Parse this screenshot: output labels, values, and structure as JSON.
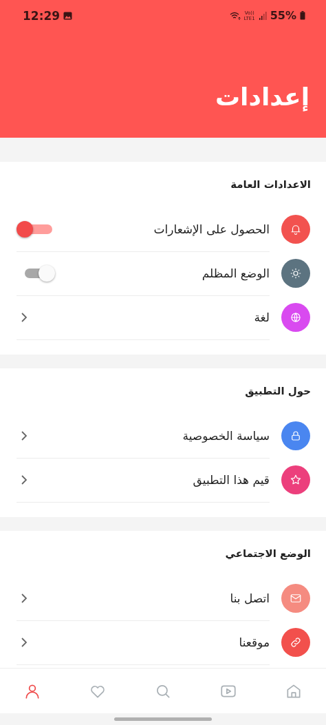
{
  "status_bar": {
    "time": "12:29",
    "network_top": "Vo))",
    "network_bottom": "LTE1",
    "battery": "55%"
  },
  "header": {
    "title": "إعدادات"
  },
  "sections": [
    {
      "title": "الاعدادات العامة",
      "rows": [
        {
          "kind": "toggle",
          "label": "الحصول على الإشعارات",
          "color": "#f2524f",
          "on": true
        },
        {
          "kind": "toggle",
          "label": "الوضع المظلم",
          "color": "#5c7380",
          "on": false
        },
        {
          "kind": "link",
          "label": "لغة",
          "color": "#d94af0"
        }
      ]
    },
    {
      "title": "حول التطبيق",
      "rows": [
        {
          "kind": "link",
          "label": "سياسة الخصوصية",
          "color": "#4a86f0"
        },
        {
          "kind": "link",
          "label": "قيم هذا التطبيق",
          "color": "#ec3f7c"
        }
      ]
    },
    {
      "title": "الوضع الاجتماعي",
      "rows": [
        {
          "kind": "link",
          "label": "اتصل بنا",
          "color": "#f58b80"
        },
        {
          "kind": "link",
          "label": "موقعنا",
          "color": "#f2504c"
        }
      ]
    }
  ],
  "bottom_nav": [
    {
      "selected": false
    },
    {
      "selected": false
    },
    {
      "selected": false
    },
    {
      "selected": false
    },
    {
      "selected": true
    }
  ]
}
